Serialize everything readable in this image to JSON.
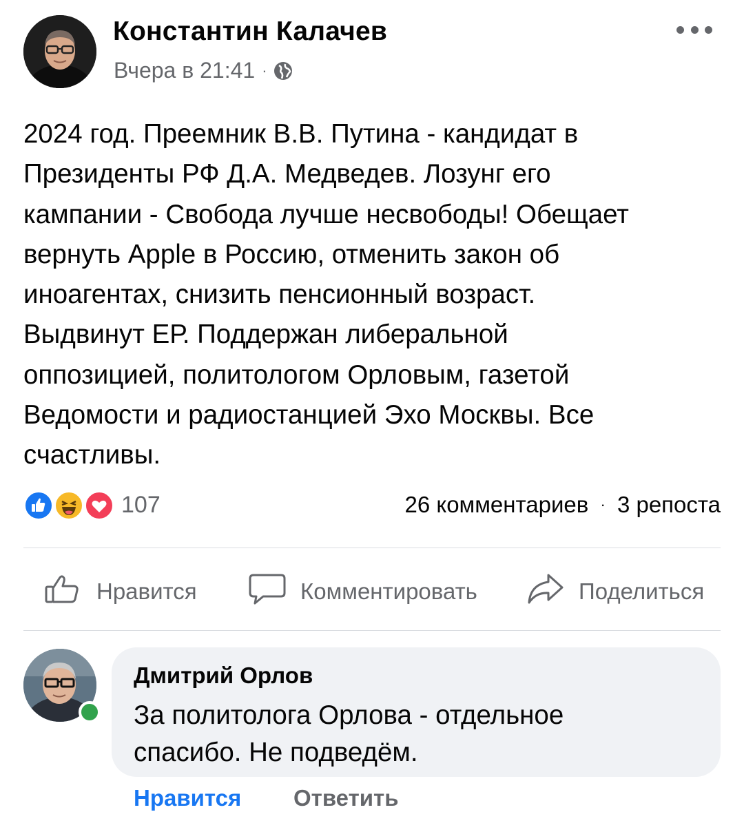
{
  "post": {
    "author": "Константин Калачев",
    "timestamp": "Вчера в 21:41",
    "meta_separator": "·",
    "audience_icon": "globe-icon",
    "more_icon": "more-horizontal-icon",
    "text_lines": [
      "2024 год. Преемник В.В. Путина - кандидат в",
      "Президенты РФ Д.А. Медведев. Лозунг его",
      "кампании - Свобода лучше несвободы! Обещает",
      "вернуть Apple в Россию, отменить закон об",
      "иноагентах, снизить пенсионный возраст.",
      "Выдвинут ЕР. Поддержан либеральной",
      "оппозицией, политологом Орловым, газетой",
      "Ведомости и радиостанцией Эхо Москвы. Все",
      "счастливы."
    ]
  },
  "reactions": {
    "icons": [
      "like-reaction-icon",
      "haha-reaction-icon",
      "love-reaction-icon"
    ],
    "count": "107",
    "comments": "26 комментариев",
    "separator": "·",
    "shares": "3 репоста"
  },
  "actions": {
    "like": "Нравится",
    "comment": "Комментировать",
    "share": "Поделиться"
  },
  "comment": {
    "author": "Дмитрий Орлов",
    "text_lines": [
      "За политолога Орлова - отдельное",
      "спасибо. Не подведём."
    ],
    "like": "Нравится",
    "reply": "Ответить"
  },
  "colors": {
    "accent": "#1877f2",
    "secondary_text": "#65676b",
    "bubble": "#f0f2f5",
    "online": "#31a24c",
    "love": "#f33e58",
    "haha": "#f7b928"
  }
}
